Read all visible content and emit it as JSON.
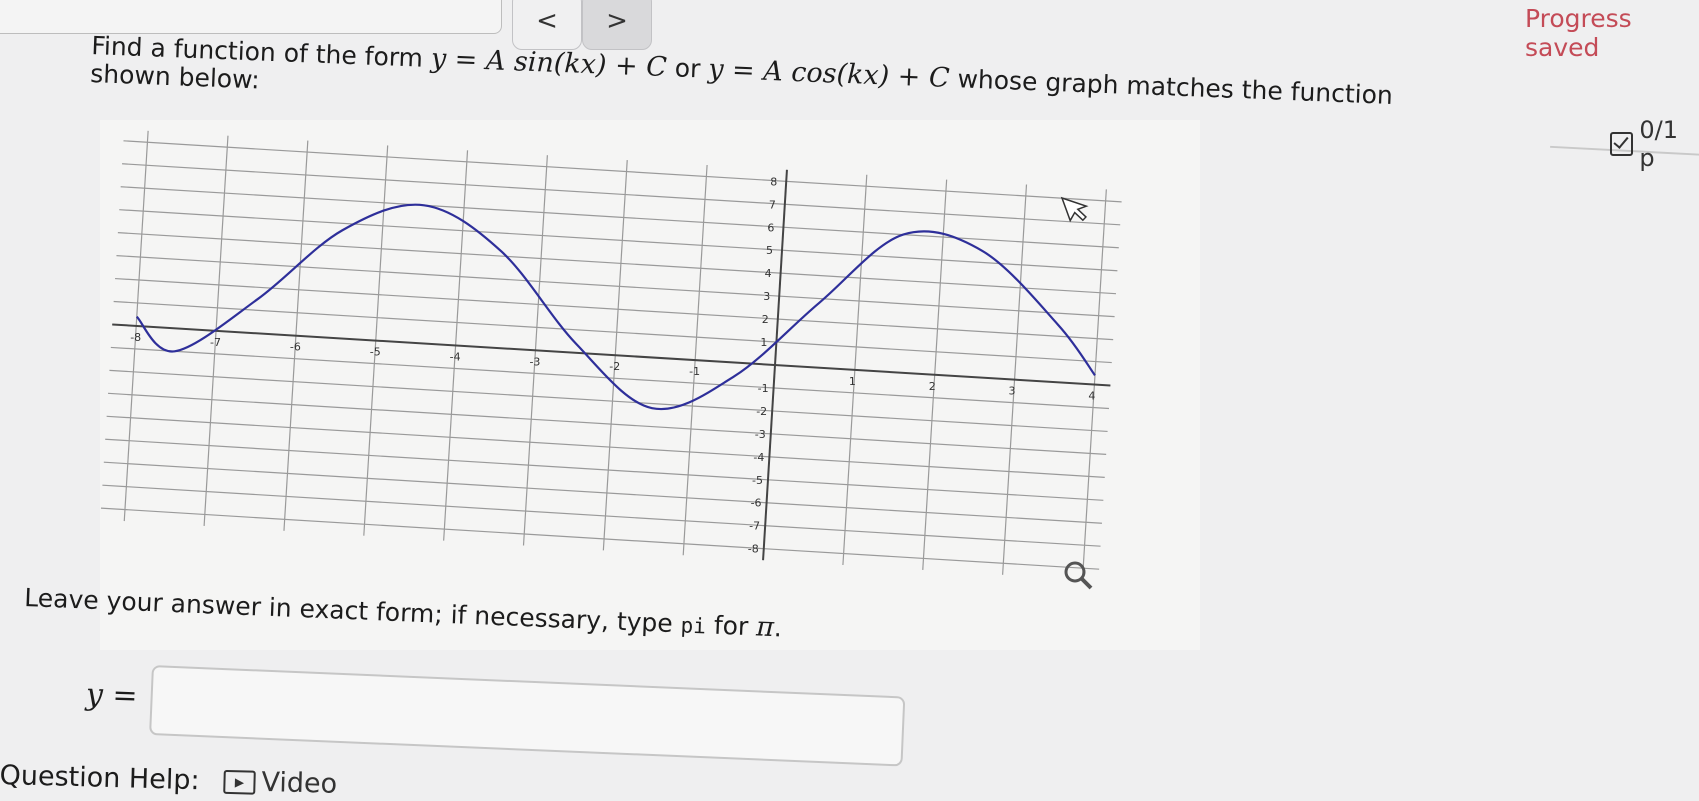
{
  "nav": {
    "prev_icon": "chevron-left-icon",
    "prev": "<",
    "next_icon": "chevron-right-icon",
    "next": ">"
  },
  "status": {
    "progress": "Progress saved",
    "score": "0/1 p"
  },
  "question": {
    "prefix": "Find a function of the form ",
    "form1": "y = A sin(kx) + C",
    "or": " or ",
    "form2": "y = A cos(kx) + C",
    "suffix": " whose graph matches the function",
    "line2": "shown below:",
    "instruction_prefix": "Leave your answer in exact form; if necessary, type ",
    "pi_code": "pi",
    "instruction_mid": " for ",
    "pi_symbol": "π",
    "instruction_end": "."
  },
  "answer": {
    "label": "y =",
    "value": ""
  },
  "help": {
    "label": "Question Help:",
    "video": "Video",
    "video_icon": "video-icon"
  },
  "graph": {
    "x_ticks": [
      "-8",
      "-7",
      "-6",
      "-5",
      "-4",
      "-3",
      "-2",
      "-1",
      "1",
      "2",
      "3",
      "4"
    ],
    "y_ticks": [
      "8",
      "7",
      "6",
      "5",
      "4",
      "3",
      "2",
      "1",
      "-1",
      "-2",
      "-3",
      "-4",
      "-5",
      "-6",
      "-7",
      "-8"
    ],
    "curve_color": "#2e2f9a",
    "cursor_icon": "cursor-arrow-icon",
    "zoom_icon": "magnifier-icon"
  },
  "chart_data": {
    "type": "line",
    "title": "",
    "xlabel": "",
    "ylabel": "",
    "xlim": [
      -8,
      4
    ],
    "ylim": [
      -8,
      8
    ],
    "grid": true,
    "series": [
      {
        "x": [
          -8,
          -7.5,
          -6.5,
          -5.5,
          -4.5,
          -3.5,
          -2.5,
          -1.5,
          -0.5,
          0.5,
          1.5,
          2.5,
          3.5,
          4
        ],
        "values": [
          0.4,
          -1,
          1.5,
          4.7,
          6,
          4.2,
          0.4,
          -2.2,
          -0.6,
          2.8,
          6,
          5.5,
          2.5,
          0.4
        ]
      }
    ]
  }
}
